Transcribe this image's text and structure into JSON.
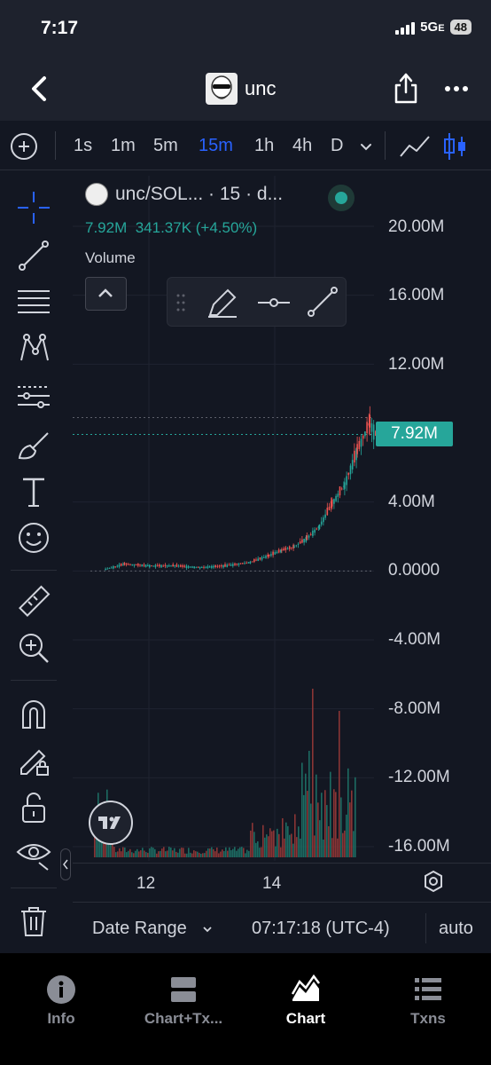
{
  "status_bar": {
    "time": "7:17",
    "network": "5G",
    "network_suffix": "E",
    "battery": "48"
  },
  "nav": {
    "token_name": "unc"
  },
  "toolbar": {
    "timeframes": [
      "1s",
      "1m",
      "5m",
      "15m",
      "1h",
      "4h",
      "D"
    ],
    "active_timeframe": "15m"
  },
  "legend": {
    "title": "unc/SOL... · 15 · d...",
    "price": "7.92M",
    "change": "341.37K (+4.50%)",
    "volume_label": "Volume"
  },
  "chart_data": {
    "type": "candlestick",
    "symbol": "unc/SOL",
    "interval": "15",
    "yaxis_ticks": [
      "20.00M",
      "16.00M",
      "12.00M",
      "7.92M",
      "4.00M",
      "0.0000",
      "-4.00M",
      "-8.00M",
      "-12.00M",
      "-16.00M"
    ],
    "ylim": [
      -16000000,
      20000000
    ],
    "last_price": 7920000,
    "last_price_label": "7.92M",
    "xaxis_ticks": [
      "12",
      "14"
    ],
    "series": [
      {
        "name": "price",
        "x": [
          11.3,
          11.6,
          12.0,
          12.4,
          12.8,
          13.2,
          13.6,
          13.9,
          14.1,
          14.3,
          14.5,
          14.7,
          14.9,
          15.1,
          15.3,
          15.5,
          15.6
        ],
        "values": [
          0.1,
          0.4,
          0.3,
          0.3,
          0.2,
          0.3,
          0.5,
          0.9,
          1.2,
          1.4,
          1.9,
          2.6,
          3.9,
          5.0,
          7.0,
          8.6,
          7.9
        ]
      }
    ],
    "grid": true,
    "colors": {
      "up": "#26a69a",
      "down": "#ef5350"
    }
  },
  "bottom": {
    "date_range": "Date Range",
    "clock": "07:17:18 (UTC-4)",
    "scale": "auto"
  },
  "tabs": [
    {
      "label": "Info",
      "icon": "info-icon"
    },
    {
      "label": "Chart+Tx...",
      "icon": "chart-tx-icon"
    },
    {
      "label": "Chart",
      "icon": "chart-icon"
    },
    {
      "label": "Txns",
      "icon": "list-icon"
    }
  ],
  "active_tab": "Chart",
  "colors": {
    "accent": "#2962ff",
    "up": "#26a69a",
    "down": "#ef5350",
    "background": "#131722",
    "panel": "#1e222d"
  }
}
